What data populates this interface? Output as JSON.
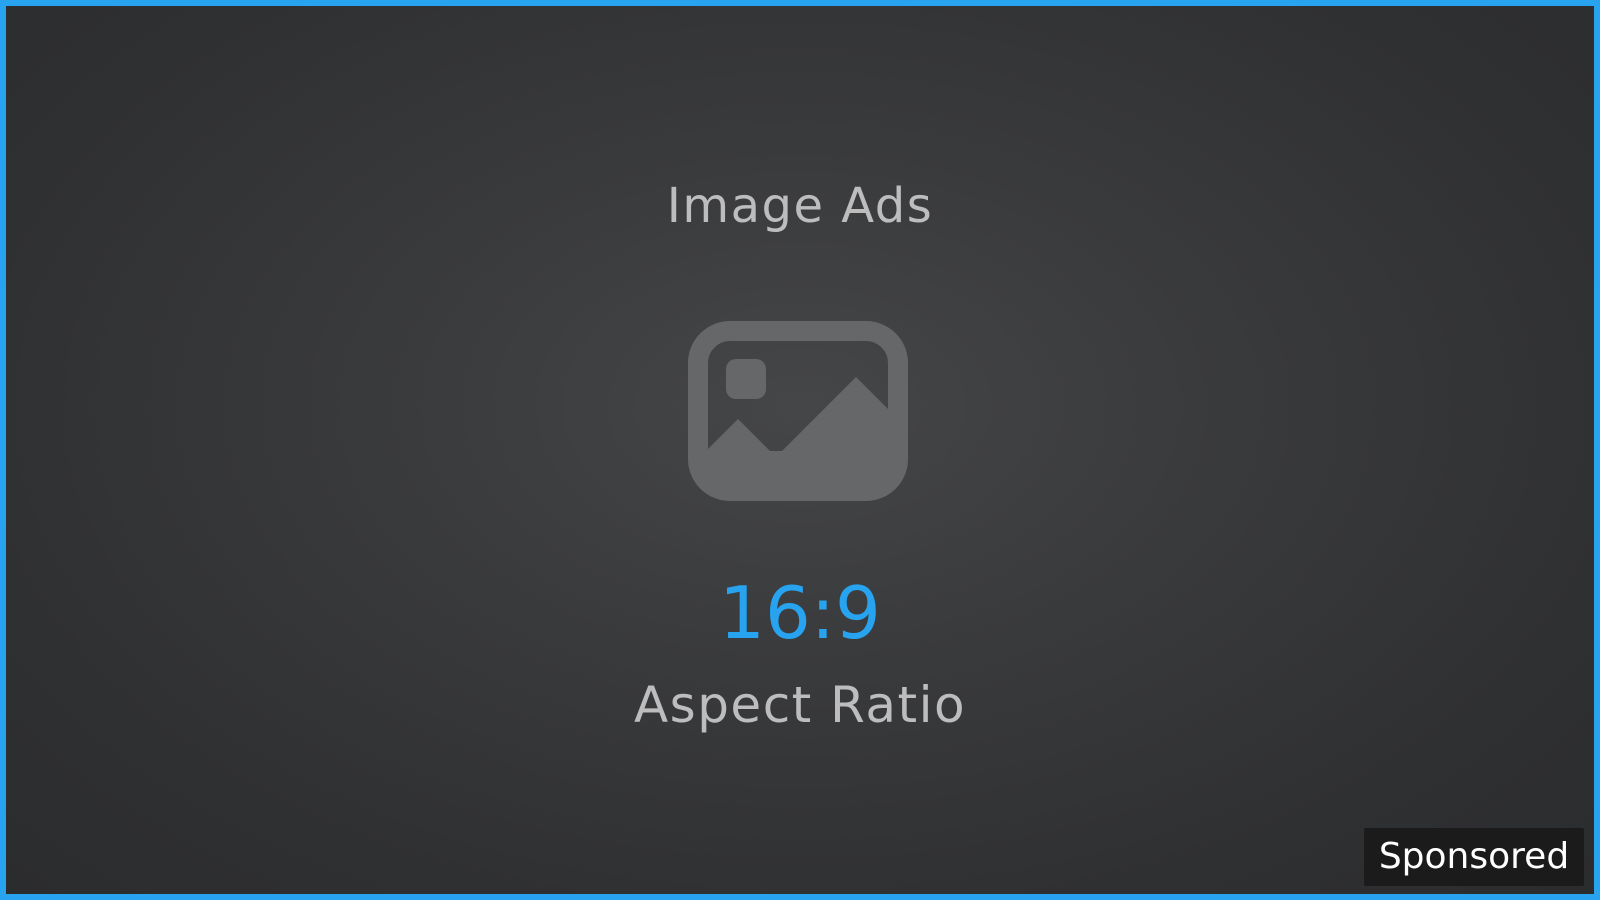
{
  "ad": {
    "title": "Image Ads",
    "ratio_value": "16:9",
    "ratio_label": "Aspect Ratio",
    "sponsored_label": "Sponsored",
    "placeholder_icon": "image-placeholder-icon"
  },
  "colors": {
    "accent": "#27a3f0",
    "background": "#3a3b3d",
    "text_muted": "#bdbdbd",
    "icon": "#666769",
    "badge_background": "#1b1b1c"
  }
}
